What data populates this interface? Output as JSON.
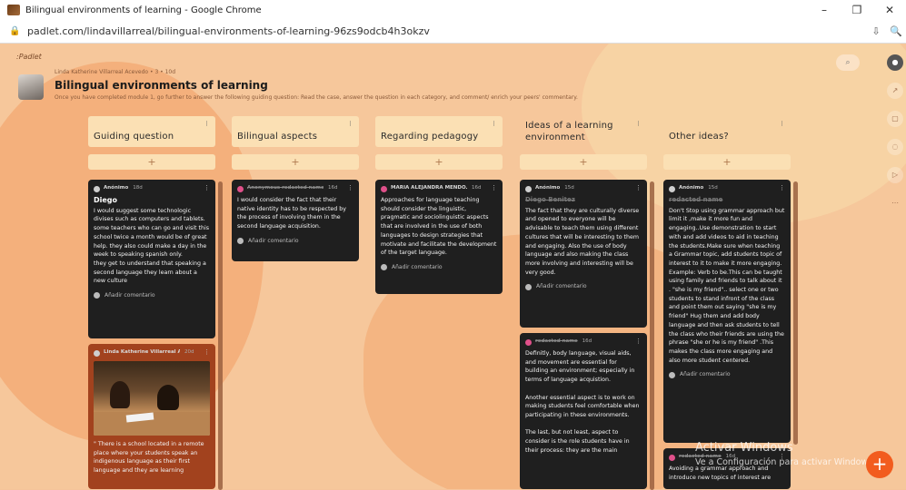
{
  "window": {
    "title": "Bilingual environments of learning - Google Chrome",
    "minimize": "–",
    "restore": "❐",
    "close": "✕"
  },
  "address": {
    "url": "padlet.com/lindavillarreal/bilingual-environments-of-learning-96zs9odcb4h3okzv"
  },
  "board": {
    "brand": "Padlet",
    "meta": "Linda Katherine Villarreal Acevedo • 3 • 10d",
    "title": "Bilingual environments of learning",
    "description": "Once you have completed module 1, go further to answer the following guiding question: Read the case, answer the question in each category, and comment/ enrich your peers' commentary."
  },
  "columns": [
    {
      "title": "Guiding question"
    },
    {
      "title": "Bilingual aspects"
    },
    {
      "title": "Regarding pedagogy"
    },
    {
      "title": "Ideas of a learning environment"
    },
    {
      "title": "Other ideas?"
    }
  ],
  "add_label": "+",
  "comment_label": "Añadir comentario",
  "cards": {
    "c1a": {
      "author": "Anónimo",
      "time": "18d",
      "title": "Diego",
      "body": "I would suggest some technologic divises such as computers and tablets. some teachers who can go and visit this school twice a month would be of great help. they also could make a day in the week to speaking spanish only.\nthey get to understand that speaking a second language they learn about a new culture"
    },
    "c1b": {
      "author": "Linda Katherine Villarreal Ac...",
      "time": "20d",
      "body": "\" There is a school located in a remote place where your students speak an indigenous language as their first language and they are learning"
    },
    "c2a": {
      "author": "Anonymous redacted name",
      "time": "16d",
      "body": "I would consider the fact that their native identity has to be respected by the process of involving them in the second language acquisition."
    },
    "c3a": {
      "author": "MARIA ALEJANDRA MENDO...",
      "time": "16d",
      "body": "Approaches for language teaching should consider the linguistic, pragmatic and sociolinguistic aspects that are involved in the use of both languages to design strategies that motivate and facilitate the development of the target language."
    },
    "c4a": {
      "author": "Anónimo",
      "time": "15d",
      "title": "Diego Benitez",
      "body": "The fact that they are culturally diverse and opened to everyone will be advisable to teach them using different cultures that will be interesting to them and engaging. Also the use of body language and also making the class more involving and interesting will be very good."
    },
    "c4b": {
      "author": "redacted name",
      "time": "16d",
      "body": "Definitly, body language, visual aids, and movement are essential for building an environment; especially in terms of language acquistion.\n\nAnother essential aspect is to work on making students feel comfortable when participating in these environments.\n\nThe last, but not least, aspect to consider is the role students have in their process: they are the main"
    },
    "c5a": {
      "author": "Anónimo",
      "time": "15d",
      "title": "redacted name",
      "body": "Don't Stop using grammar approach but limit it ,make it more fun and engaging..Use demonstration to start with and add videos to aid in teaching the students.Make sure when teaching a Grammar topic, add students topic of interest to it to make it more engaging.\nExample: Verb to be.This can be taught using family and friends to talk about it . \"she is my friend\".. select one or two students to stand infront of the class and point them out saying \"she is my friend\" Hug them and add body language and then ask students to tell the class who their friends are using the phrase \"she or he is my friend\" .This makes the class more engaging and also more student centered."
    },
    "c5b": {
      "author": "redacted name",
      "time": "16d",
      "body": "Avoiding a grammar approach and introduce new topics of interest are"
    }
  },
  "watermark": {
    "line1": "Activar Windows",
    "line2": "Ve a Configuración para activar Windows."
  },
  "icons": {
    "search": "search-icon",
    "more": "more-vertical-icon",
    "fab": "+"
  },
  "colors": {
    "accent": "#f25c1e",
    "card": "#1f1f1f",
    "card_orange": "#a2421e",
    "header": "#fbe0b4"
  }
}
